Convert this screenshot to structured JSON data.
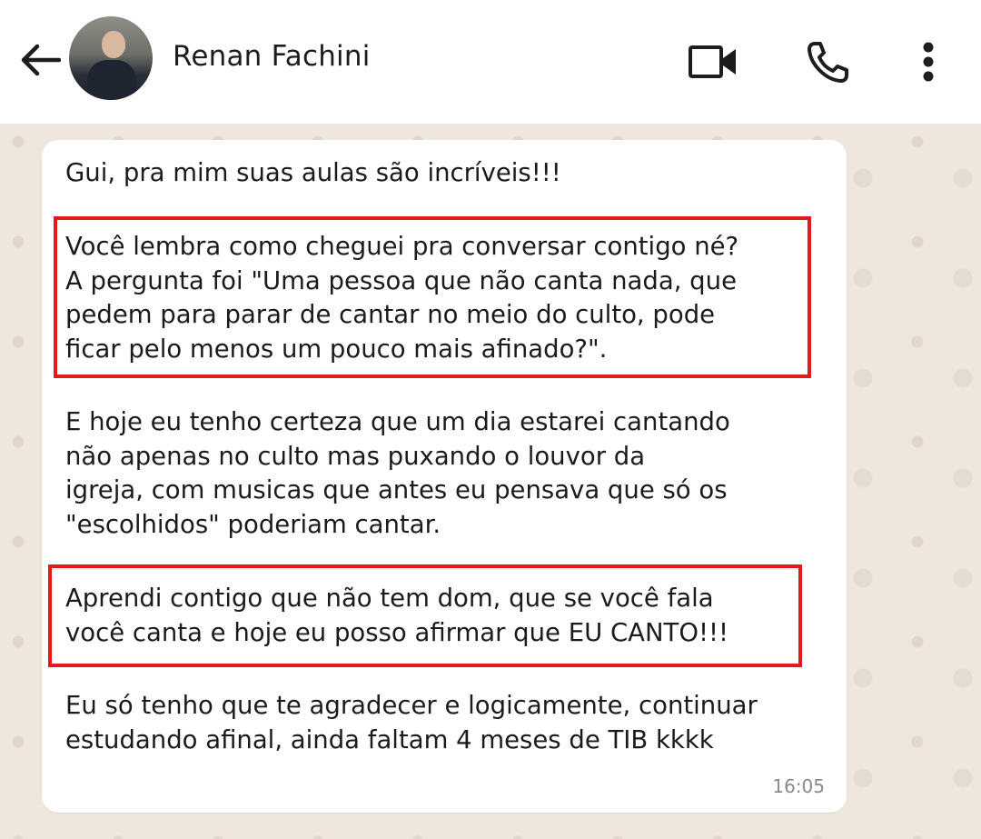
{
  "header": {
    "contact_name": "Renan Fachini",
    "icons": [
      "back-arrow-icon",
      "video-call-icon",
      "phone-call-icon",
      "more-options-icon"
    ]
  },
  "message": {
    "paragraphs": [
      "Gui, pra mim suas aulas são incríveis!!!",
      "Você lembra como cheguei pra conversar contigo né?\nA pergunta foi \"Uma pessoa que não canta nada, que\npedem para parar de cantar no meio do culto, pode\nficar pelo menos um pouco mais afinado?\".",
      "E hoje eu tenho certeza que um dia estarei cantando\nnão apenas no culto mas puxando o louvor da\nigreja, com musicas que antes eu pensava que só os\n\"escolhidos\" poderiam cantar.",
      "Aprendi contigo que não tem dom, que se você fala\nvocê canta e hoje eu posso afirmar que EU CANTO!!!",
      "Eu só tenho que te agradecer e logicamente, continuar\nestudando afinal, ainda faltam 4 meses de TIB kkkk"
    ],
    "time": "16:05"
  },
  "colors": {
    "highlight_border": "#e11a1a",
    "chat_background": "#efe7de",
    "bubble": "#ffffff"
  }
}
